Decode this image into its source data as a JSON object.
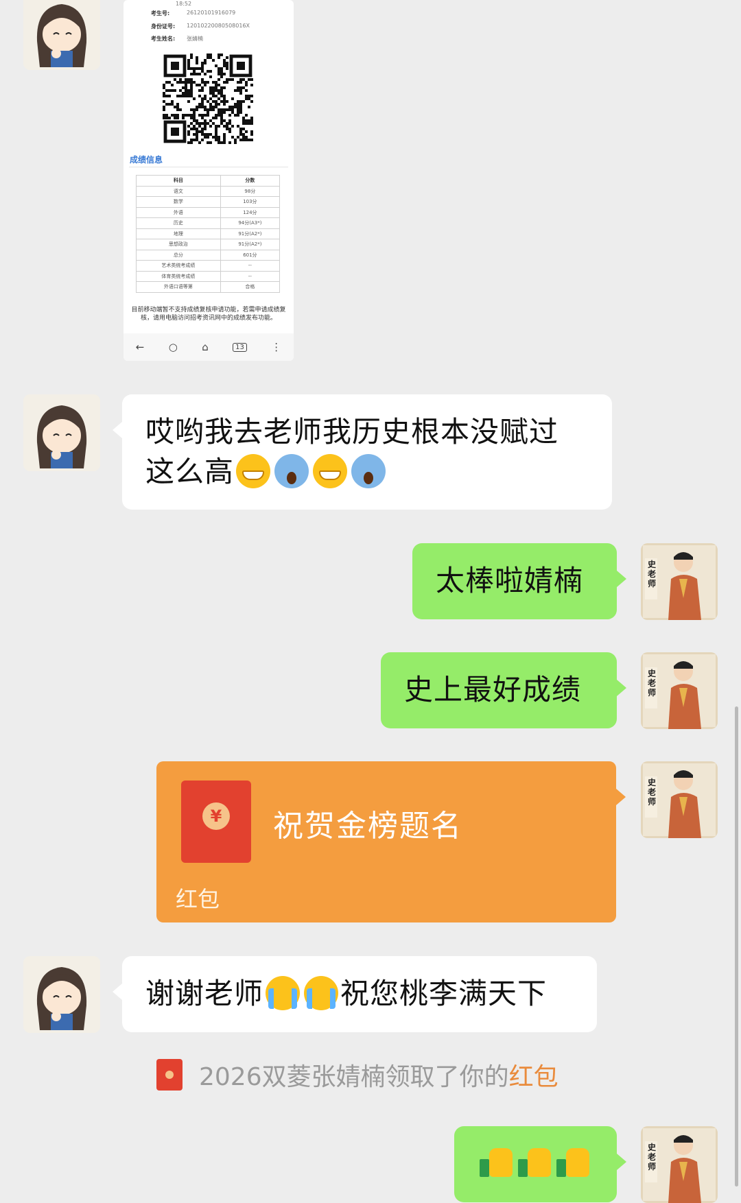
{
  "screenshot": {
    "status_time": "18:52",
    "fields": [
      {
        "label": "考生号:",
        "value": "26120101916079"
      },
      {
        "label": "身份证号:",
        "value": "12010220080508016X"
      },
      {
        "label": "考生姓名:",
        "value": "张婧楠"
      }
    ],
    "score_title": "成绩信息",
    "table_headers": [
      "科目",
      "分数"
    ],
    "table_rows": [
      [
        "语文",
        "98分"
      ],
      [
        "数学",
        "103分"
      ],
      [
        "外语",
        "124分"
      ],
      [
        "历史",
        "94分(A3*)"
      ],
      [
        "地理",
        "91分(A2*)"
      ],
      [
        "思想政治",
        "91分(A2*)"
      ],
      [
        "总分",
        "601分"
      ],
      [
        "艺术类统考成绩",
        "--"
      ],
      [
        "体育类统考成绩",
        "--"
      ],
      [
        "外语口语等第",
        "合格"
      ]
    ],
    "note": "目前移动端暂不支持成绩复核申请功能，若需申请成绩复核，请用电脑访问招考资讯网中的成绩发布功能。",
    "nav": [
      "←",
      "○",
      "⌂",
      "13",
      "⋮"
    ]
  },
  "messages": {
    "m1_line1": "哎哟我去老师我历史根本没赋过",
    "m1_line2": "这么高",
    "m2": "太棒啦婧楠",
    "m3": "史上最好成绩",
    "packet_title": "祝贺金榜题名",
    "packet_label": "红包",
    "m4_a": "谢谢老师",
    "m4_b": "祝您桃李满天下",
    "system_text": "2026双菱张婧楠领取了你的",
    "system_link": "红包"
  },
  "avatars": {
    "teacher_text": "史老师",
    "teacher_side": "历史老师"
  },
  "colors": {
    "background": "#ededed",
    "bubble_green": "#95ec69",
    "bubble_white": "#ffffff",
    "packet_orange": "#f49d3f",
    "packet_red": "#e2412f"
  }
}
